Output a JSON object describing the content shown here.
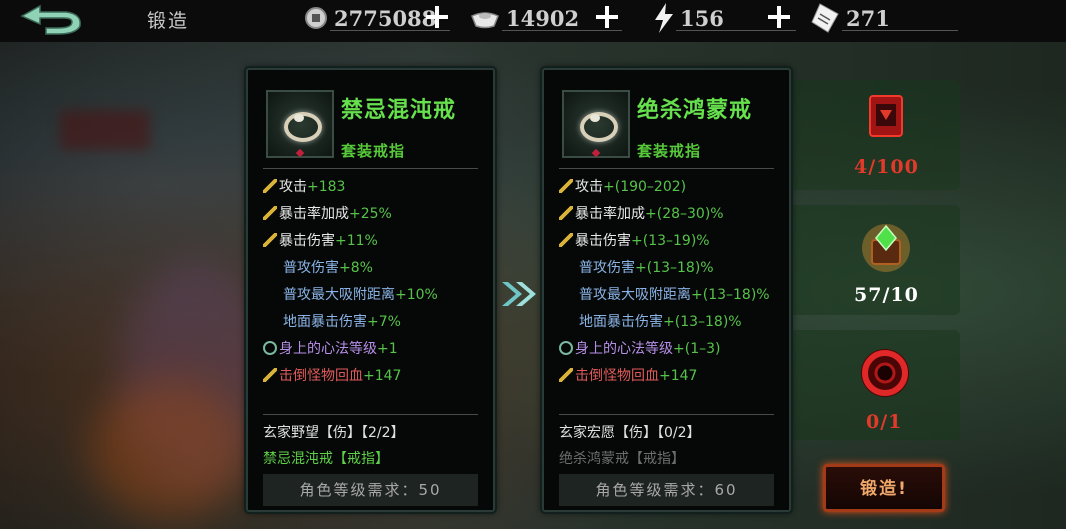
{
  "header": {
    "title": "锻造",
    "resources": [
      {
        "icon": "silver-coin-icon",
        "value": "2775088"
      },
      {
        "icon": "silver-ingot-icon",
        "value": "14902"
      },
      {
        "icon": "lightning-energy-icon",
        "value": "156"
      },
      {
        "icon": "ticket-icon",
        "value": "271"
      }
    ]
  },
  "current_item": {
    "name": "禁忌混沌戒",
    "type": "套装戒指",
    "stats": [
      {
        "label": "攻击",
        "value": "+183",
        "icon": "hammer-icon",
        "style": "white"
      },
      {
        "label": "暴击率加成",
        "value": "+25%",
        "icon": "hammer-icon",
        "style": "white"
      },
      {
        "label": "暴击伤害",
        "value": "+11%",
        "icon": "hammer-icon",
        "style": "white"
      },
      {
        "label": "普攻伤害",
        "value": "+8%",
        "icon": "",
        "style": "blue"
      },
      {
        "label": "普攻最大吸附距离",
        "value": "+10%",
        "icon": "",
        "style": "blue"
      },
      {
        "label": "地面暴击伤害",
        "value": "+7%",
        "icon": "",
        "style": "blue"
      },
      {
        "label": "身上的心法等级",
        "value": "+1",
        "icon": "cycle-icon",
        "style": "purple"
      },
      {
        "label": "击倒怪物回血",
        "value": "+147",
        "icon": "hammer-icon",
        "style": "red"
      }
    ],
    "set_name": "玄家野望【伤】【2/2】",
    "set_item": "禁忌混沌戒【戒指】",
    "requirement": "角色等级需求：50"
  },
  "target_item": {
    "name": "绝杀鸿蒙戒",
    "type": "套装戒指",
    "stats": [
      {
        "label": "攻击",
        "value": "+(190–202)",
        "icon": "hammer-icon",
        "style": "white"
      },
      {
        "label": "暴击率加成",
        "value": "+(28–30)%",
        "icon": "hammer-icon",
        "style": "white"
      },
      {
        "label": "暴击伤害",
        "value": "+(13–19)%",
        "icon": "hammer-icon",
        "style": "white"
      },
      {
        "label": "普攻伤害",
        "value": "+(13–18)%",
        "icon": "",
        "style": "blue"
      },
      {
        "label": "普攻最大吸附距离",
        "value": "+(13–18)%",
        "icon": "",
        "style": "blue"
      },
      {
        "label": "地面暴击伤害",
        "value": "+(13–18)%",
        "icon": "",
        "style": "blue"
      },
      {
        "label": "身上的心法等级",
        "value": "+(1–3)",
        "icon": "cycle-icon",
        "style": "purple"
      },
      {
        "label": "击倒怪物回血",
        "value": "+147",
        "icon": "hammer-icon",
        "style": "red"
      }
    ],
    "set_name": "玄家宏愿【伤】【0/2】",
    "set_item": "绝杀鸿蒙戒【戒指】",
    "requirement": "角色等级需求：60"
  },
  "materials": [
    {
      "icon": "red-tome-icon",
      "count": "4/100",
      "color": "#e23a2a"
    },
    {
      "icon": "green-gem-chest-icon",
      "count": "57/10",
      "color": "#ffffff"
    },
    {
      "icon": "crimson-ring-icon",
      "count": "0/1",
      "color": "#e23a2a"
    }
  ],
  "forge_button": "锻造!"
}
